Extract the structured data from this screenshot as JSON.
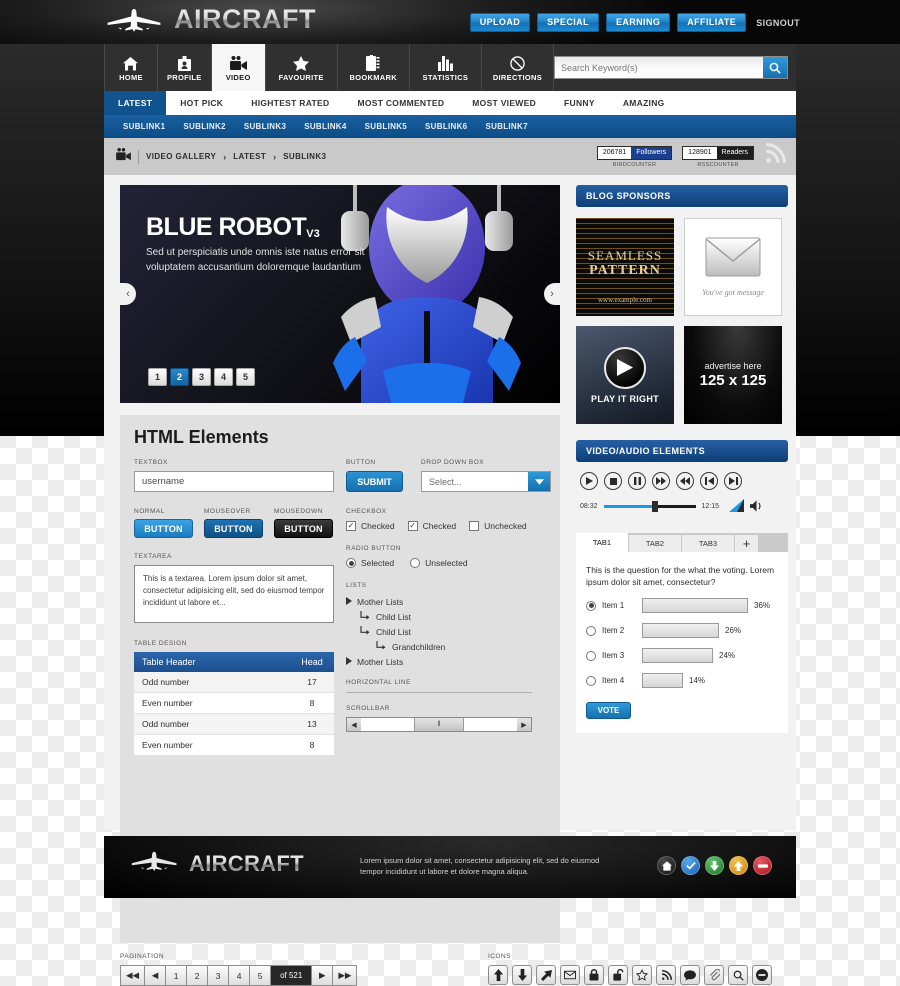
{
  "header": {
    "brand": "AIRCRAFT",
    "logo_icon": "airplane-icon",
    "buttons": [
      {
        "label": "UPLOAD"
      },
      {
        "label": "SPECIAL"
      },
      {
        "label": "EARNING"
      },
      {
        "label": "AFFILIATE"
      }
    ],
    "signout": "SIGNOUT"
  },
  "mainnav": {
    "items": [
      {
        "label": "HOME",
        "icon": "home-icon",
        "active": false
      },
      {
        "label": "PROFILE",
        "icon": "profile-icon",
        "active": false
      },
      {
        "label": "VIDEO",
        "icon": "video-camera-icon",
        "active": true
      },
      {
        "label": "FAVOURITE",
        "icon": "star-icon",
        "active": false
      },
      {
        "label": "BOOKMARK",
        "icon": "notebook-icon",
        "active": false
      },
      {
        "label": "STATISTICS",
        "icon": "bar-chart-icon",
        "active": false
      },
      {
        "label": "DIRECTIONS",
        "icon": "no-entry-icon",
        "active": false
      }
    ],
    "search": {
      "placeholder": "Search Keyword(s)",
      "value": "",
      "icon": "search-icon"
    }
  },
  "tabsnav": [
    {
      "label": "LATEST",
      "active": true
    },
    {
      "label": "HOT PICK",
      "active": false
    },
    {
      "label": "HIGHTEST RATED",
      "active": false
    },
    {
      "label": "MOST COMMENTED",
      "active": false
    },
    {
      "label": "MOST VIEWED",
      "active": false
    },
    {
      "label": "FUNNY",
      "active": false
    },
    {
      "label": "AMAZING",
      "active": false
    }
  ],
  "sublinks": [
    "SUBLINK1",
    "SUBLINK2",
    "SUBLINK3",
    "SUBLINK4",
    "SUBLINK5",
    "SUBLINK6",
    "SUBLINK7"
  ],
  "breadcrumb": {
    "icon": "video-camera-icon",
    "items": [
      "VIDEO GALLERY",
      "LATEST",
      "SUBLINK3"
    ],
    "separator": "›",
    "counters": [
      {
        "number": "206781",
        "tag": "Followers",
        "caption": "BIRDCOUNTER",
        "style": "blue"
      },
      {
        "number": "128901",
        "tag": "Readers",
        "caption": "RSSCOUNTER",
        "style": "black"
      }
    ],
    "rss_icon": "rss-icon"
  },
  "hero": {
    "title": "BLUE ROBOT",
    "title_sup": "V3",
    "description": "Sed ut perspiciatis unde omnis iste natus error sit voluptatem accusantium doloremque laudantium",
    "dots": [
      "1",
      "2",
      "3",
      "4",
      "5"
    ],
    "active_dot": "2",
    "prev_icon": "chevron-left-icon",
    "next_icon": "chevron-right-icon",
    "prev_glyph": "‹",
    "next_glyph": "›"
  },
  "elements": {
    "title": "HTML Elements",
    "textbox": {
      "label": "TEXTBOX",
      "value": "username",
      "placeholder": "username"
    },
    "button": {
      "label": "BUTTON",
      "submit_label": "SUBMIT"
    },
    "dropdown": {
      "label": "DROP DOWN BOX",
      "value": "Select...",
      "arrow_icon": "chevron-down-icon"
    },
    "button_states": [
      {
        "label": "NORMAL",
        "text": "BUTTON"
      },
      {
        "label": "MOUSEOVER",
        "text": "BUTTON"
      },
      {
        "label": "MOUSEDOWN",
        "text": "BUTTON"
      }
    ],
    "checkbox": {
      "label": "CHECKBOX",
      "items": [
        {
          "text": "Checked",
          "checked": true
        },
        {
          "text": "Checked",
          "checked": true
        },
        {
          "text": "Unchecked",
          "checked": false
        }
      ]
    },
    "radio": {
      "label": "RADIO BUTTON",
      "items": [
        {
          "text": "Selected",
          "selected": true
        },
        {
          "text": "Unselected",
          "selected": false
        }
      ]
    },
    "textarea": {
      "label": "TEXTAREA",
      "value": "This is a textarea. Lorem ipsum dolor sit amet, consectetur adipisicing elit, sed do eiusmod tempor incididunt ut labore et..."
    },
    "lists": {
      "label": "LISTS",
      "items": [
        {
          "text": "Mother Lists",
          "level": 0,
          "icon": "triangle-right-icon"
        },
        {
          "text": "Child List",
          "level": 1,
          "icon": "arrow-child-icon"
        },
        {
          "text": "Child List",
          "level": 1,
          "icon": "arrow-child-icon"
        },
        {
          "text": "Grandchildren",
          "level": 2,
          "icon": "arrow-child-icon"
        },
        {
          "text": "Mother Lists",
          "level": 0,
          "icon": "triangle-right-icon"
        }
      ]
    },
    "hr": {
      "label": "HORIZONTAL LINE"
    },
    "scrollbar": {
      "label": "SCROLLBAR",
      "left_icon": "arrow-left-icon",
      "right_icon": "arrow-right-icon",
      "grip": "‖"
    },
    "table": {
      "label": "TABLE DESIGN",
      "headers": [
        "Table Header",
        "Head"
      ],
      "rows": [
        [
          "Odd number",
          "17"
        ],
        [
          "Even number",
          "8"
        ],
        [
          "Odd number",
          "13"
        ],
        [
          "Even number",
          "8"
        ]
      ]
    }
  },
  "pagination": {
    "label": "PAGINATION",
    "first_icon": "double-arrow-left-icon",
    "prev_icon": "arrow-left-icon",
    "pages": [
      "1",
      "2",
      "3",
      "4",
      "5"
    ],
    "of_label": "of 521",
    "next_icon": "arrow-right-icon",
    "last_icon": "double-arrow-right-icon"
  },
  "icons": {
    "label": "ICONS",
    "items": [
      {
        "name": "arrow-up-icon",
        "glyph": "⬆"
      },
      {
        "name": "arrow-down-icon",
        "glyph": "⬇"
      },
      {
        "name": "arrow-diagonal-icon",
        "glyph": "⬈"
      },
      {
        "name": "envelope-icon",
        "glyph": "✉"
      },
      {
        "name": "lock-closed-icon",
        "glyph": "🔒"
      },
      {
        "name": "lock-open-icon",
        "glyph": "🔓"
      },
      {
        "name": "star-icon",
        "glyph": "☆"
      },
      {
        "name": "rss-icon",
        "glyph": "rss"
      },
      {
        "name": "comment-icon",
        "glyph": "●"
      },
      {
        "name": "paperclip-icon",
        "glyph": "📎"
      },
      {
        "name": "search-icon",
        "glyph": "🔍"
      },
      {
        "name": "minus-circle-icon",
        "glyph": "⊖"
      }
    ]
  },
  "sidebar": {
    "sponsors": {
      "title": "BLOG SPONSORS",
      "items": [
        {
          "name": "seamless-pattern-ad",
          "line1": "SEAMLESS",
          "line2": "PATTERN",
          "line3": "www.example.com"
        },
        {
          "name": "envelope-ad",
          "caption": "You've got message",
          "icon": "envelope-icon"
        },
        {
          "name": "play-it-right-ad",
          "caption": "PLAY IT RIGHT",
          "icon": "play-icon"
        },
        {
          "name": "advertise-here-ad",
          "line1": "advertise here",
          "line2": "125 x 125"
        }
      ]
    },
    "player": {
      "title": "VIDEO/AUDIO ELEMENTS",
      "controls": [
        {
          "name": "play-button",
          "glyph": "▶"
        },
        {
          "name": "stop-button",
          "glyph": "■"
        },
        {
          "name": "pause-button",
          "glyph": "❙❙"
        },
        {
          "name": "fast-forward-button",
          "glyph": "▶▶"
        },
        {
          "name": "rewind-button",
          "glyph": "◀◀"
        },
        {
          "name": "previous-track-button",
          "glyph": "⏮"
        },
        {
          "name": "next-track-button",
          "glyph": "⏭"
        }
      ],
      "current_time": "08:32",
      "total_time": "12:15",
      "volume_icon": "volume-icon"
    },
    "tabs": [
      {
        "label": "TAB1",
        "active": true
      },
      {
        "label": "TAB2",
        "active": false
      },
      {
        "label": "TAB3",
        "active": false
      }
    ],
    "tab_add": "+",
    "poll": {
      "question": "This is the question for the what the voting. Lorem ipsum dolor sit amet, consectetur?",
      "options": [
        {
          "label": "Item 1",
          "percent": "36%",
          "value": 36,
          "selected": true
        },
        {
          "label": "Item 2",
          "percent": "26%",
          "value": 26,
          "selected": false
        },
        {
          "label": "Item 3",
          "percent": "24%",
          "value": 24,
          "selected": false
        },
        {
          "label": "Item 4",
          "percent": "14%",
          "value": 14,
          "selected": false
        }
      ],
      "vote_label": "VOTE"
    }
  },
  "footer": {
    "brand": "AIRCRAFT",
    "logo_icon": "airplane-icon",
    "text": "Lorem ipsum dolor sit amet, consectetur adipisicing elit, sed do eiusmod tempor incididunt ut labore et dolore magna aliqua.",
    "icons": [
      {
        "name": "home-circle-icon",
        "color": "#2b2b2b",
        "glyph": "⌂"
      },
      {
        "name": "check-circle-icon",
        "color": "#2a7fd0",
        "glyph": "✓"
      },
      {
        "name": "download-circle-icon",
        "color": "#2f9e3f",
        "glyph": "↓"
      },
      {
        "name": "upload-circle-icon",
        "color": "#e5a021",
        "glyph": "↑"
      },
      {
        "name": "minus-circle-icon",
        "color": "#cf2130",
        "glyph": "−"
      }
    ]
  },
  "colors": {
    "accent_blue": "#1b7fc4",
    "dark_blue": "#0e3f76",
    "dark": "#111111"
  }
}
